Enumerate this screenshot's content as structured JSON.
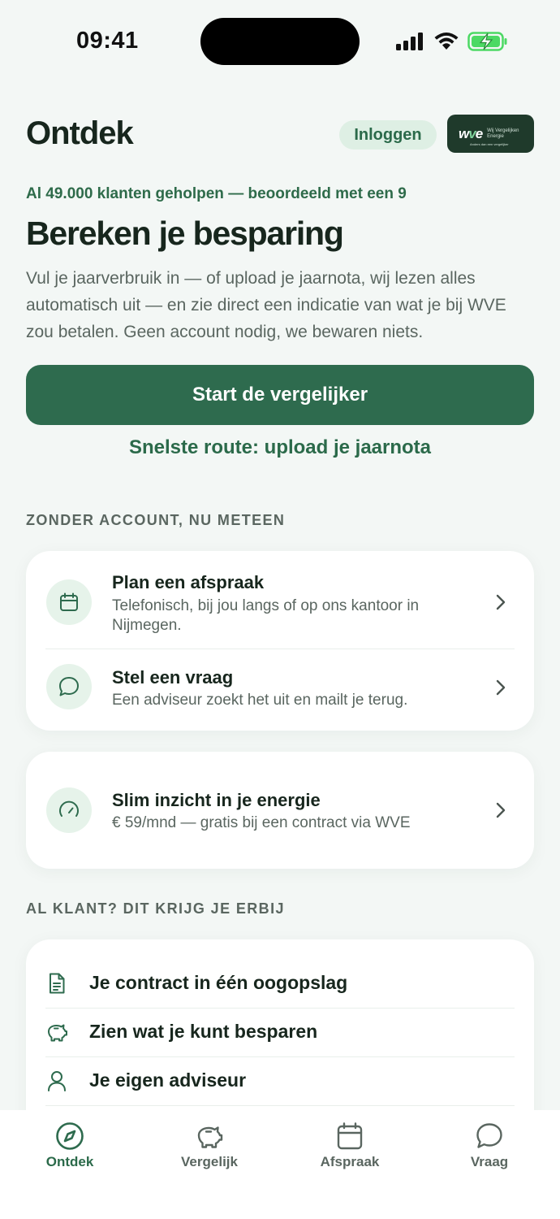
{
  "status_bar": {
    "time": "09:41"
  },
  "header": {
    "title": "Ontdek",
    "login_label": "Inloggen",
    "logo": {
      "mark": "WVE",
      "name": "Wij Vergelijken Energie",
      "tagline": "Anders dan een vergelijker"
    }
  },
  "hero": {
    "tagline": "Al 49.000 klanten geholpen — beoordeeld met een 9",
    "title": "Bereken je besparing",
    "body": "Vul je jaarverbruik in — of upload je jaarnota, wij lezen alles automatisch uit — en zie direct een indicatie van wat je bij WVE zou betalen. Geen account nodig, we bewaren niets.",
    "cta_label": "Start de vergelijker",
    "secondary_link": "Snelste route: upload je jaarnota"
  },
  "no_account": {
    "section_label": "ZONDER ACCOUNT, NU METEEN",
    "items": [
      {
        "title": "Plan een afspraak",
        "subtitle": "Telefonisch, bij jou langs of op ons kantoor in Nijmegen.",
        "icon": "calendar-icon"
      },
      {
        "title": "Stel een vraag",
        "subtitle": "Een adviseur zoekt het uit en mailt je terug.",
        "icon": "chat-bubble-icon"
      }
    ],
    "insight": {
      "title": "Slim inzicht in je energie",
      "subtitle": "€ 59/mnd — gratis bij een contract via WVE",
      "icon": "gauge-icon"
    }
  },
  "customer": {
    "section_label": "AL KLANT? DIT KRIJG JE ERBIJ",
    "perks": [
      {
        "label": "Je contract in één oogopslag",
        "icon": "document-icon"
      },
      {
        "label": "Zien wat je kunt besparen",
        "icon": "piggy-bank-icon"
      },
      {
        "label": "Je eigen adviseur",
        "icon": "user-icon"
      }
    ]
  },
  "tab_bar": {
    "tabs": [
      {
        "label": "Ontdek",
        "icon": "compass-icon",
        "active": true
      },
      {
        "label": "Vergelijk",
        "icon": "piggy-bank-icon",
        "active": false
      },
      {
        "label": "Afspraak",
        "icon": "calendar-icon",
        "active": false
      },
      {
        "label": "Vraag",
        "icon": "chat-bubble-icon",
        "active": false
      }
    ]
  },
  "colors": {
    "brand_green": "#2e6b4e",
    "accent_text": "#2b6a4a",
    "icon_bg": "#e6f3ea",
    "page_bg": "#f3f7f5",
    "battery_green": "#4cd964"
  }
}
